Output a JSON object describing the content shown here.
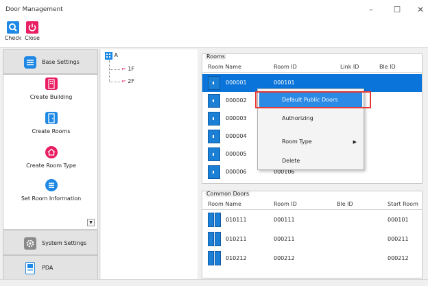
{
  "window": {
    "title": "Door Management",
    "minimize": "–",
    "maximize": "☐",
    "close": "✕"
  },
  "toolbar": {
    "check_label": "Check",
    "close_label": "Close",
    "check_color": "#1e88e5",
    "close_color": "#e91e63"
  },
  "sidebar": {
    "base_settings": "Base Settings",
    "items": [
      {
        "label": "Create Building",
        "icon": "building-icon",
        "color": "#e91e63"
      },
      {
        "label": "Create Rooms",
        "icon": "door-icon",
        "color": "#1e88e5"
      },
      {
        "label": "Create Room Type",
        "icon": "house-icon",
        "color": "#e91e63"
      },
      {
        "label": "Set Room Information",
        "icon": "list-icon",
        "color": "#1e88e5"
      }
    ],
    "scroll_down": "▼",
    "system_settings": "System Settings",
    "pda": "PDA"
  },
  "tree": {
    "root": "A",
    "floors": [
      "1F",
      "2F"
    ]
  },
  "rooms": {
    "title": "Rooms",
    "headers": [
      "Room Name",
      "Room ID",
      "Link ID",
      "Ble ID"
    ],
    "rows": [
      {
        "name": "000001",
        "id": "000101",
        "selected": true
      },
      {
        "name": "000002",
        "id": ""
      },
      {
        "name": "000003",
        "id": ""
      },
      {
        "name": "000004",
        "id": ""
      },
      {
        "name": "000005",
        "id": ""
      },
      {
        "name": "000006",
        "id": "000106"
      }
    ]
  },
  "common_doors": {
    "title": "Common Doors",
    "headers": [
      "Room Name",
      "Room ID",
      "Ble ID",
      "Start Room"
    ],
    "rows": [
      {
        "name": "010111",
        "id": "000111",
        "start": "000101"
      },
      {
        "name": "010211",
        "id": "000211",
        "start": "000211"
      },
      {
        "name": "010212",
        "id": "000212",
        "start": "000212"
      }
    ]
  },
  "context_menu": {
    "items": [
      "Default Public Doors",
      "Authorizing",
      "Room Type",
      "Delete"
    ],
    "submenu_arrow": "▶",
    "highlight_color": "#2b8ae6",
    "annotation_color": "#e53935"
  }
}
